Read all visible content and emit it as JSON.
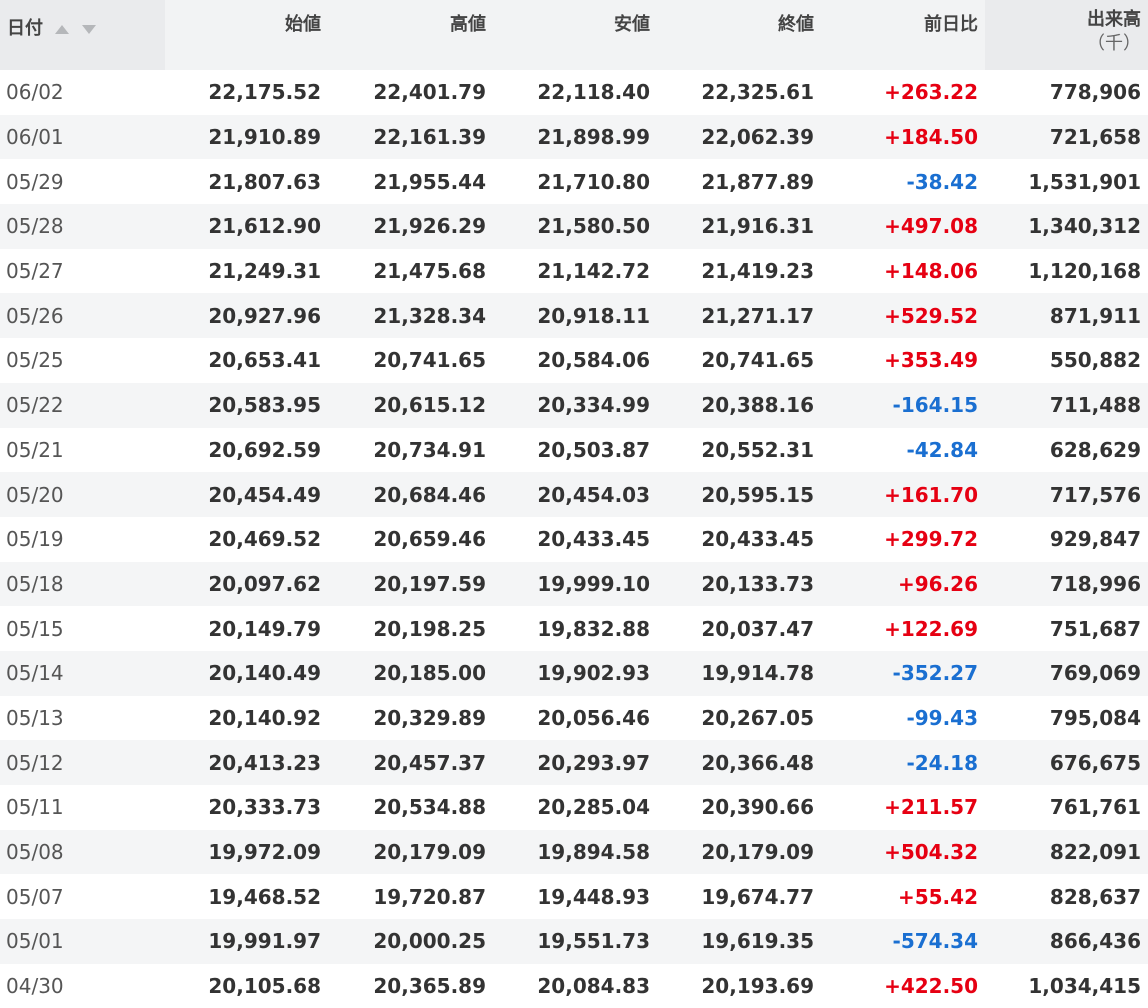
{
  "table": {
    "headers": {
      "date": "日付",
      "open": "始値",
      "high": "高値",
      "low": "安値",
      "close": "終値",
      "change": "前日比",
      "volume": "出来高",
      "volume_unit": "（千）"
    },
    "colors": {
      "up": "#e60012",
      "down": "#1a6fd1"
    },
    "rows": [
      {
        "date": "06/02",
        "open": "22,175.52",
        "high": "22,401.79",
        "low": "22,118.40",
        "close": "22,325.61",
        "change": "+263.22",
        "dir": "up",
        "volume": "778,906"
      },
      {
        "date": "06/01",
        "open": "21,910.89",
        "high": "22,161.39",
        "low": "21,898.99",
        "close": "22,062.39",
        "change": "+184.50",
        "dir": "up",
        "volume": "721,658"
      },
      {
        "date": "05/29",
        "open": "21,807.63",
        "high": "21,955.44",
        "low": "21,710.80",
        "close": "21,877.89",
        "change": "-38.42",
        "dir": "down",
        "volume": "1,531,901"
      },
      {
        "date": "05/28",
        "open": "21,612.90",
        "high": "21,926.29",
        "low": "21,580.50",
        "close": "21,916.31",
        "change": "+497.08",
        "dir": "up",
        "volume": "1,340,312"
      },
      {
        "date": "05/27",
        "open": "21,249.31",
        "high": "21,475.68",
        "low": "21,142.72",
        "close": "21,419.23",
        "change": "+148.06",
        "dir": "up",
        "volume": "1,120,168"
      },
      {
        "date": "05/26",
        "open": "20,927.96",
        "high": "21,328.34",
        "low": "20,918.11",
        "close": "21,271.17",
        "change": "+529.52",
        "dir": "up",
        "volume": "871,911"
      },
      {
        "date": "05/25",
        "open": "20,653.41",
        "high": "20,741.65",
        "low": "20,584.06",
        "close": "20,741.65",
        "change": "+353.49",
        "dir": "up",
        "volume": "550,882"
      },
      {
        "date": "05/22",
        "open": "20,583.95",
        "high": "20,615.12",
        "low": "20,334.99",
        "close": "20,388.16",
        "change": "-164.15",
        "dir": "down",
        "volume": "711,488"
      },
      {
        "date": "05/21",
        "open": "20,692.59",
        "high": "20,734.91",
        "low": "20,503.87",
        "close": "20,552.31",
        "change": "-42.84",
        "dir": "down",
        "volume": "628,629"
      },
      {
        "date": "05/20",
        "open": "20,454.49",
        "high": "20,684.46",
        "low": "20,454.03",
        "close": "20,595.15",
        "change": "+161.70",
        "dir": "up",
        "volume": "717,576"
      },
      {
        "date": "05/19",
        "open": "20,469.52",
        "high": "20,659.46",
        "low": "20,433.45",
        "close": "20,433.45",
        "change": "+299.72",
        "dir": "up",
        "volume": "929,847"
      },
      {
        "date": "05/18",
        "open": "20,097.62",
        "high": "20,197.59",
        "low": "19,999.10",
        "close": "20,133.73",
        "change": "+96.26",
        "dir": "up",
        "volume": "718,996"
      },
      {
        "date": "05/15",
        "open": "20,149.79",
        "high": "20,198.25",
        "low": "19,832.88",
        "close": "20,037.47",
        "change": "+122.69",
        "dir": "up",
        "volume": "751,687"
      },
      {
        "date": "05/14",
        "open": "20,140.49",
        "high": "20,185.00",
        "low": "19,902.93",
        "close": "19,914.78",
        "change": "-352.27",
        "dir": "down",
        "volume": "769,069"
      },
      {
        "date": "05/13",
        "open": "20,140.92",
        "high": "20,329.89",
        "low": "20,056.46",
        "close": "20,267.05",
        "change": "-99.43",
        "dir": "down",
        "volume": "795,084"
      },
      {
        "date": "05/12",
        "open": "20,413.23",
        "high": "20,457.37",
        "low": "20,293.97",
        "close": "20,366.48",
        "change": "-24.18",
        "dir": "down",
        "volume": "676,675"
      },
      {
        "date": "05/11",
        "open": "20,333.73",
        "high": "20,534.88",
        "low": "20,285.04",
        "close": "20,390.66",
        "change": "+211.57",
        "dir": "up",
        "volume": "761,761"
      },
      {
        "date": "05/08",
        "open": "19,972.09",
        "high": "20,179.09",
        "low": "19,894.58",
        "close": "20,179.09",
        "change": "+504.32",
        "dir": "up",
        "volume": "822,091"
      },
      {
        "date": "05/07",
        "open": "19,468.52",
        "high": "19,720.87",
        "low": "19,448.93",
        "close": "19,674.77",
        "change": "+55.42",
        "dir": "up",
        "volume": "828,637"
      },
      {
        "date": "05/01",
        "open": "19,991.97",
        "high": "20,000.25",
        "low": "19,551.73",
        "close": "19,619.35",
        "change": "-574.34",
        "dir": "down",
        "volume": "866,436"
      },
      {
        "date": "04/30",
        "open": "20,105.68",
        "high": "20,365.89",
        "low": "20,084.83",
        "close": "20,193.69",
        "change": "+422.50",
        "dir": "up",
        "volume": "1,034,415"
      }
    ]
  }
}
